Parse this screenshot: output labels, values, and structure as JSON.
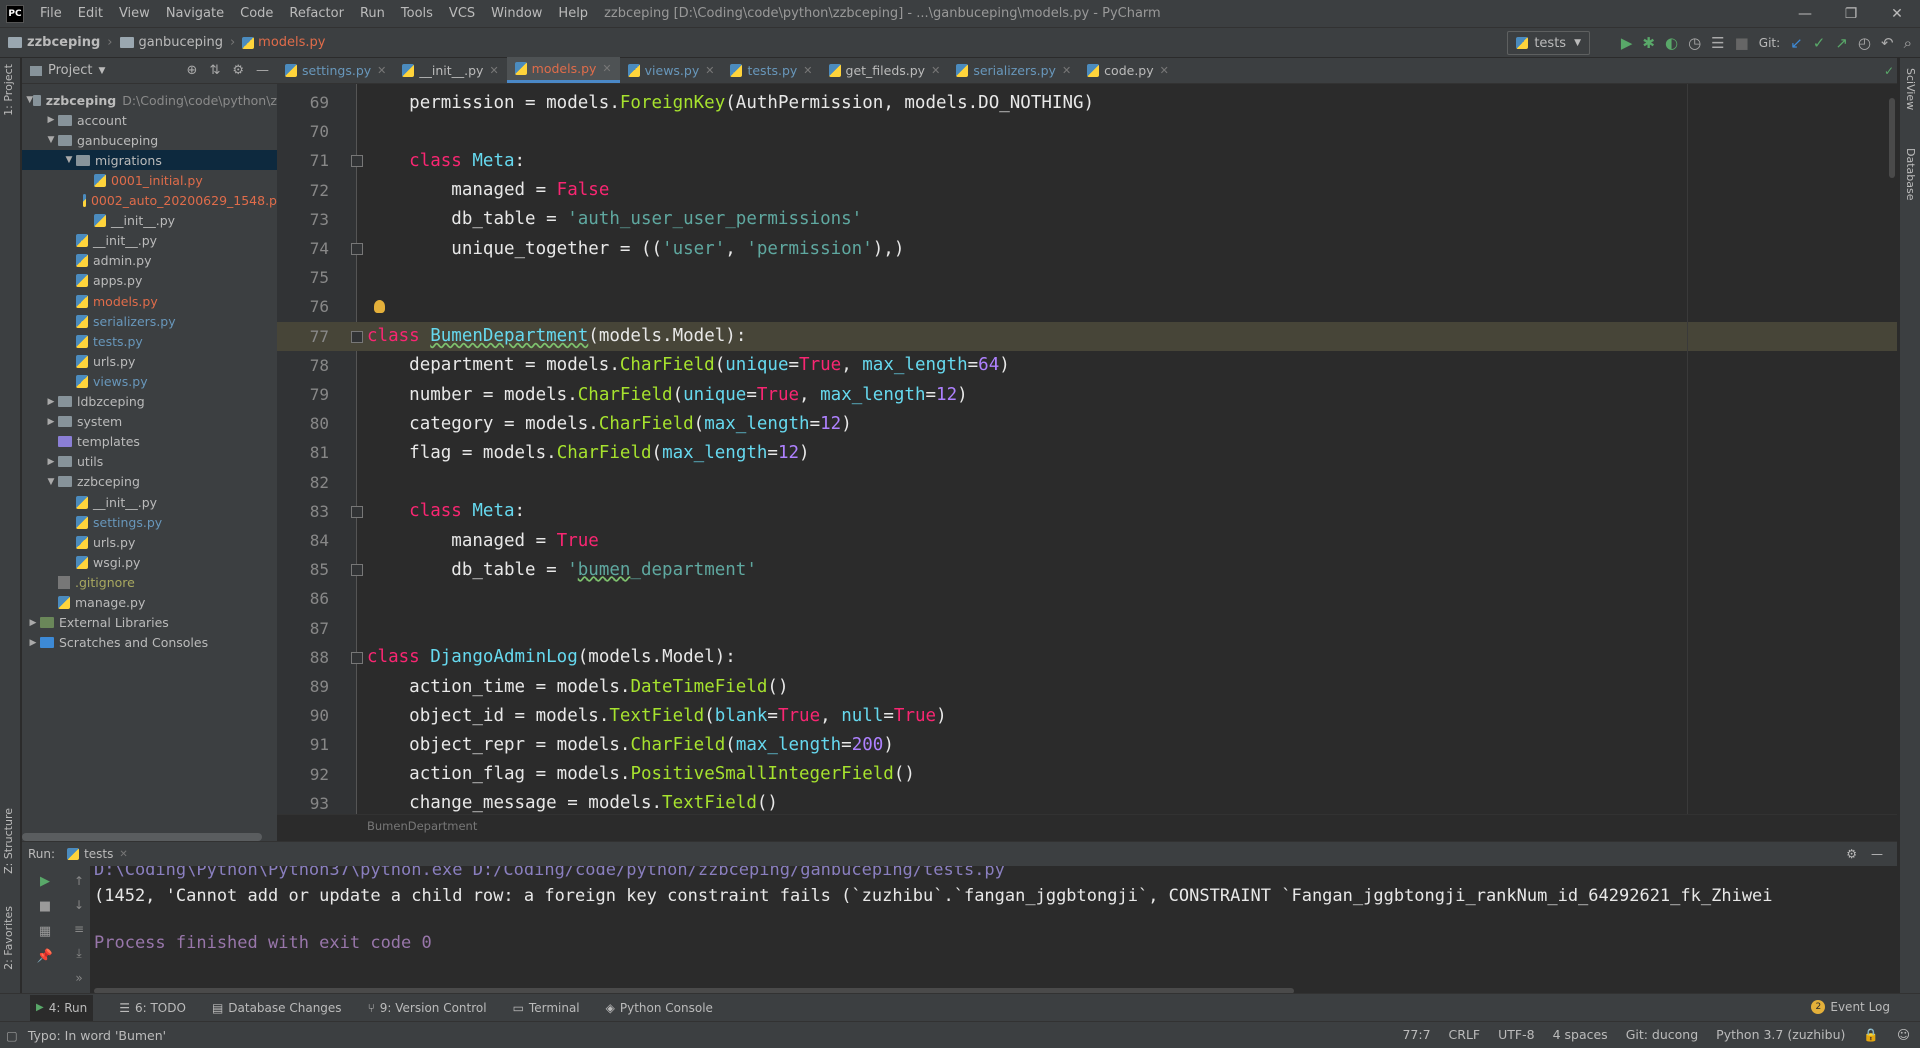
{
  "menu": [
    "File",
    "Edit",
    "View",
    "Navigate",
    "Code",
    "Refactor",
    "Run",
    "Tools",
    "VCS",
    "Window",
    "Help"
  ],
  "window_title": "zzbceping [D:\\Coding\\code\\python\\zzbceping] - ...\\ganbuceping\\models.py - PyCharm",
  "breadcrumb": [
    "zzbceping",
    "ganbuceping",
    "models.py"
  ],
  "run_config": "tests",
  "git_label": "Git:",
  "project_panel": {
    "title": "Project",
    "tree": [
      {
        "label": "zzbceping",
        "extra": "D:\\Coding\\code\\python\\z",
        "indent": 0,
        "type": "folder",
        "expanded": true,
        "color": "norm",
        "bold": true
      },
      {
        "label": "account",
        "indent": 1,
        "type": "folder",
        "expanded": false,
        "color": "norm"
      },
      {
        "label": "ganbuceping",
        "indent": 1,
        "type": "folder",
        "expanded": true,
        "color": "norm"
      },
      {
        "label": "migrations",
        "indent": 2,
        "type": "folder",
        "expanded": true,
        "color": "norm",
        "selected": true
      },
      {
        "label": "0001_initial.py",
        "indent": 3,
        "type": "py",
        "color": "red"
      },
      {
        "label": "0002_auto_20200629_1548.p",
        "indent": 3,
        "type": "py",
        "color": "red"
      },
      {
        "label": "__init__.py",
        "indent": 3,
        "type": "py",
        "color": "norm"
      },
      {
        "label": "__init__.py",
        "indent": 2,
        "type": "py",
        "color": "norm"
      },
      {
        "label": "admin.py",
        "indent": 2,
        "type": "py",
        "color": "norm"
      },
      {
        "label": "apps.py",
        "indent": 2,
        "type": "py",
        "color": "norm"
      },
      {
        "label": "models.py",
        "indent": 2,
        "type": "py",
        "color": "red"
      },
      {
        "label": "serializers.py",
        "indent": 2,
        "type": "py",
        "color": "blue"
      },
      {
        "label": "tests.py",
        "indent": 2,
        "type": "py",
        "color": "blue"
      },
      {
        "label": "urls.py",
        "indent": 2,
        "type": "py",
        "color": "norm"
      },
      {
        "label": "views.py",
        "indent": 2,
        "type": "py",
        "color": "blue"
      },
      {
        "label": "ldbzceping",
        "indent": 1,
        "type": "folder",
        "expanded": false,
        "color": "norm"
      },
      {
        "label": "system",
        "indent": 1,
        "type": "folder",
        "expanded": false,
        "color": "norm"
      },
      {
        "label": "templates",
        "indent": 1,
        "type": "folder-tpl",
        "color": "norm"
      },
      {
        "label": "utils",
        "indent": 1,
        "type": "folder",
        "expanded": false,
        "color": "norm"
      },
      {
        "label": "zzbceping",
        "indent": 1,
        "type": "folder",
        "expanded": true,
        "color": "norm"
      },
      {
        "label": "__init__.py",
        "indent": 2,
        "type": "py",
        "color": "norm"
      },
      {
        "label": "settings.py",
        "indent": 2,
        "type": "py",
        "color": "blue"
      },
      {
        "label": "urls.py",
        "indent": 2,
        "type": "py",
        "color": "norm"
      },
      {
        "label": "wsgi.py",
        "indent": 2,
        "type": "py",
        "color": "norm"
      },
      {
        "label": ".gitignore",
        "indent": 1,
        "type": "file",
        "color": "olive"
      },
      {
        "label": "manage.py",
        "indent": 1,
        "type": "py",
        "color": "norm"
      },
      {
        "label": "External Libraries",
        "indent": 0,
        "type": "lib",
        "expanded": false,
        "color": "norm"
      },
      {
        "label": "Scratches and Consoles",
        "indent": 0,
        "type": "scratch",
        "expanded": false,
        "color": "norm"
      }
    ]
  },
  "tabs": [
    {
      "label": "settings.py",
      "color": "blue"
    },
    {
      "label": "__init__.py",
      "color": "norm"
    },
    {
      "label": "models.py",
      "color": "red",
      "active": true
    },
    {
      "label": "views.py",
      "color": "blue"
    },
    {
      "label": "tests.py",
      "color": "blue"
    },
    {
      "label": "get_fileds.py",
      "color": "norm"
    },
    {
      "label": "serializers.py",
      "color": "blue"
    },
    {
      "label": "code.py",
      "color": "norm"
    }
  ],
  "code_lines": [
    {
      "n": "69",
      "html": "    <span class='ident'>permission</span> = <span class='ident'>models</span>.<span class='fn'>ForeignKey</span>(<span class='ident'>AuthPermission</span>, <span class='ident'>models</span>.<span class='ident'>DO_NOTHING</span>)"
    },
    {
      "n": "70",
      "html": ""
    },
    {
      "n": "71",
      "html": "    <span class='kw'>class</span> <span class='cls'>Meta</span>:"
    },
    {
      "n": "72",
      "html": "        <span class='ident'>managed</span> = <span class='kw'>False</span>"
    },
    {
      "n": "73",
      "html": "        <span class='ident'>db_table</span> = <span class='str'>'auth_user_user_permissions'</span>"
    },
    {
      "n": "74",
      "html": "        <span class='ident'>unique_together</span> = ((<span class='str'>'user'</span>, <span class='str'>'permission'</span>),)"
    },
    {
      "n": "75",
      "html": ""
    },
    {
      "n": "76",
      "html": ""
    },
    {
      "n": "77",
      "html": "<span class='kw'>class</span> <span class='cls' style='text-decoration:underline wavy #7ec26e'>BumenDepartment</span>(<span class='ident'>models</span>.<span class='ident'>Model</span>):",
      "caret": true
    },
    {
      "n": "78",
      "html": "    <span class='ident'>department</span> = <span class='ident'>models</span>.<span class='fn'>CharField</span>(<span class='prm'>unique</span>=<span class='kw'>True</span>, <span class='prm'>max_length</span>=<span class='num2'>64</span>)"
    },
    {
      "n": "79",
      "html": "    <span class='ident'>number</span> = <span class='ident'>models</span>.<span class='fn'>CharField</span>(<span class='prm'>unique</span>=<span class='kw'>True</span>, <span class='prm'>max_length</span>=<span class='num2'>12</span>)"
    },
    {
      "n": "80",
      "html": "    <span class='ident'>category</span> = <span class='ident'>models</span>.<span class='fn'>CharField</span>(<span class='prm'>max_length</span>=<span class='num2'>12</span>)"
    },
    {
      "n": "81",
      "html": "    <span class='ident'>flag</span> = <span class='ident'>models</span>.<span class='fn'>CharField</span>(<span class='prm'>max_length</span>=<span class='num2'>12</span>)"
    },
    {
      "n": "82",
      "html": ""
    },
    {
      "n": "83",
      "html": "    <span class='kw'>class</span> <span class='cls'>Meta</span>:"
    },
    {
      "n": "84",
      "html": "        <span class='ident'>managed</span> = <span class='kw'>True</span>"
    },
    {
      "n": "85",
      "html": "        <span class='ident'>db_table</span> = <span class='str'>'<span style=\"text-decoration:underline wavy #7ec26e\">bumen</span>_department'</span>"
    },
    {
      "n": "86",
      "html": ""
    },
    {
      "n": "87",
      "html": ""
    },
    {
      "n": "88",
      "html": "<span class='kw'>class</span> <span class='cls'>DjangoAdminLog</span>(<span class='ident'>models</span>.<span class='ident'>Model</span>):"
    },
    {
      "n": "89",
      "html": "    <span class='ident'>action_time</span> = <span class='ident'>models</span>.<span class='fn'>DateTimeField</span>()"
    },
    {
      "n": "90",
      "html": "    <span class='ident'>object_id</span> = <span class='ident'>models</span>.<span class='fn'>TextField</span>(<span class='prm'>blank</span>=<span class='kw'>True</span>, <span class='prm'>null</span>=<span class='kw'>True</span>)"
    },
    {
      "n": "91",
      "html": "    <span class='ident'>object_repr</span> = <span class='ident'>models</span>.<span class='fn'>CharField</span>(<span class='prm'>max_length</span>=<span class='num2'>200</span>)"
    },
    {
      "n": "92",
      "html": "    <span class='ident'>action_flag</span> = <span class='ident'>models</span>.<span class='fn'>PositiveSmallIntegerField</span>()"
    },
    {
      "n": "93",
      "html": "    <span class='ident'>change_message</span> = <span class='ident'>models</span>.<span class='fn'>TextField</span>()"
    }
  ],
  "editor_breadcrumb": "BumenDepartment",
  "run_panel": {
    "label": "Run:",
    "tab": "tests",
    "path_line": "D:\\Coding\\Python\\Python37\\python.exe D:/Coding/code/python/zzbceping/ganbuceping/tests.py",
    "error_line": "(1452, 'Cannot add or update a child row: a foreign key constraint fails (`zuzhibu`.`fangan_jggbtongji`, CONSTRAINT `Fangan_jggbtongji_rankNum_id_64292621_fk_Zhiwei",
    "finish_line": "Process finished with exit code 0"
  },
  "bottom_tabs": [
    "4: Run",
    "6: TODO",
    "Database Changes",
    "9: Version Control",
    "Terminal",
    "Python Console"
  ],
  "event_log": "Event Log",
  "event_log_count": "2",
  "status": {
    "message": "Typo: In word 'Bumen'",
    "position": "77:7",
    "line_sep": "CRLF",
    "encoding": "UTF-8",
    "indent": "4 spaces",
    "git": "Git: ducong",
    "interpreter": "Python 3.7 (zuzhibu)"
  },
  "side_tabs": {
    "left_top": "1: Project",
    "left_bottom1": "Z: Structure",
    "left_bottom2": "2: Favorites",
    "right_top": "SciView",
    "right_mid": "Database"
  }
}
